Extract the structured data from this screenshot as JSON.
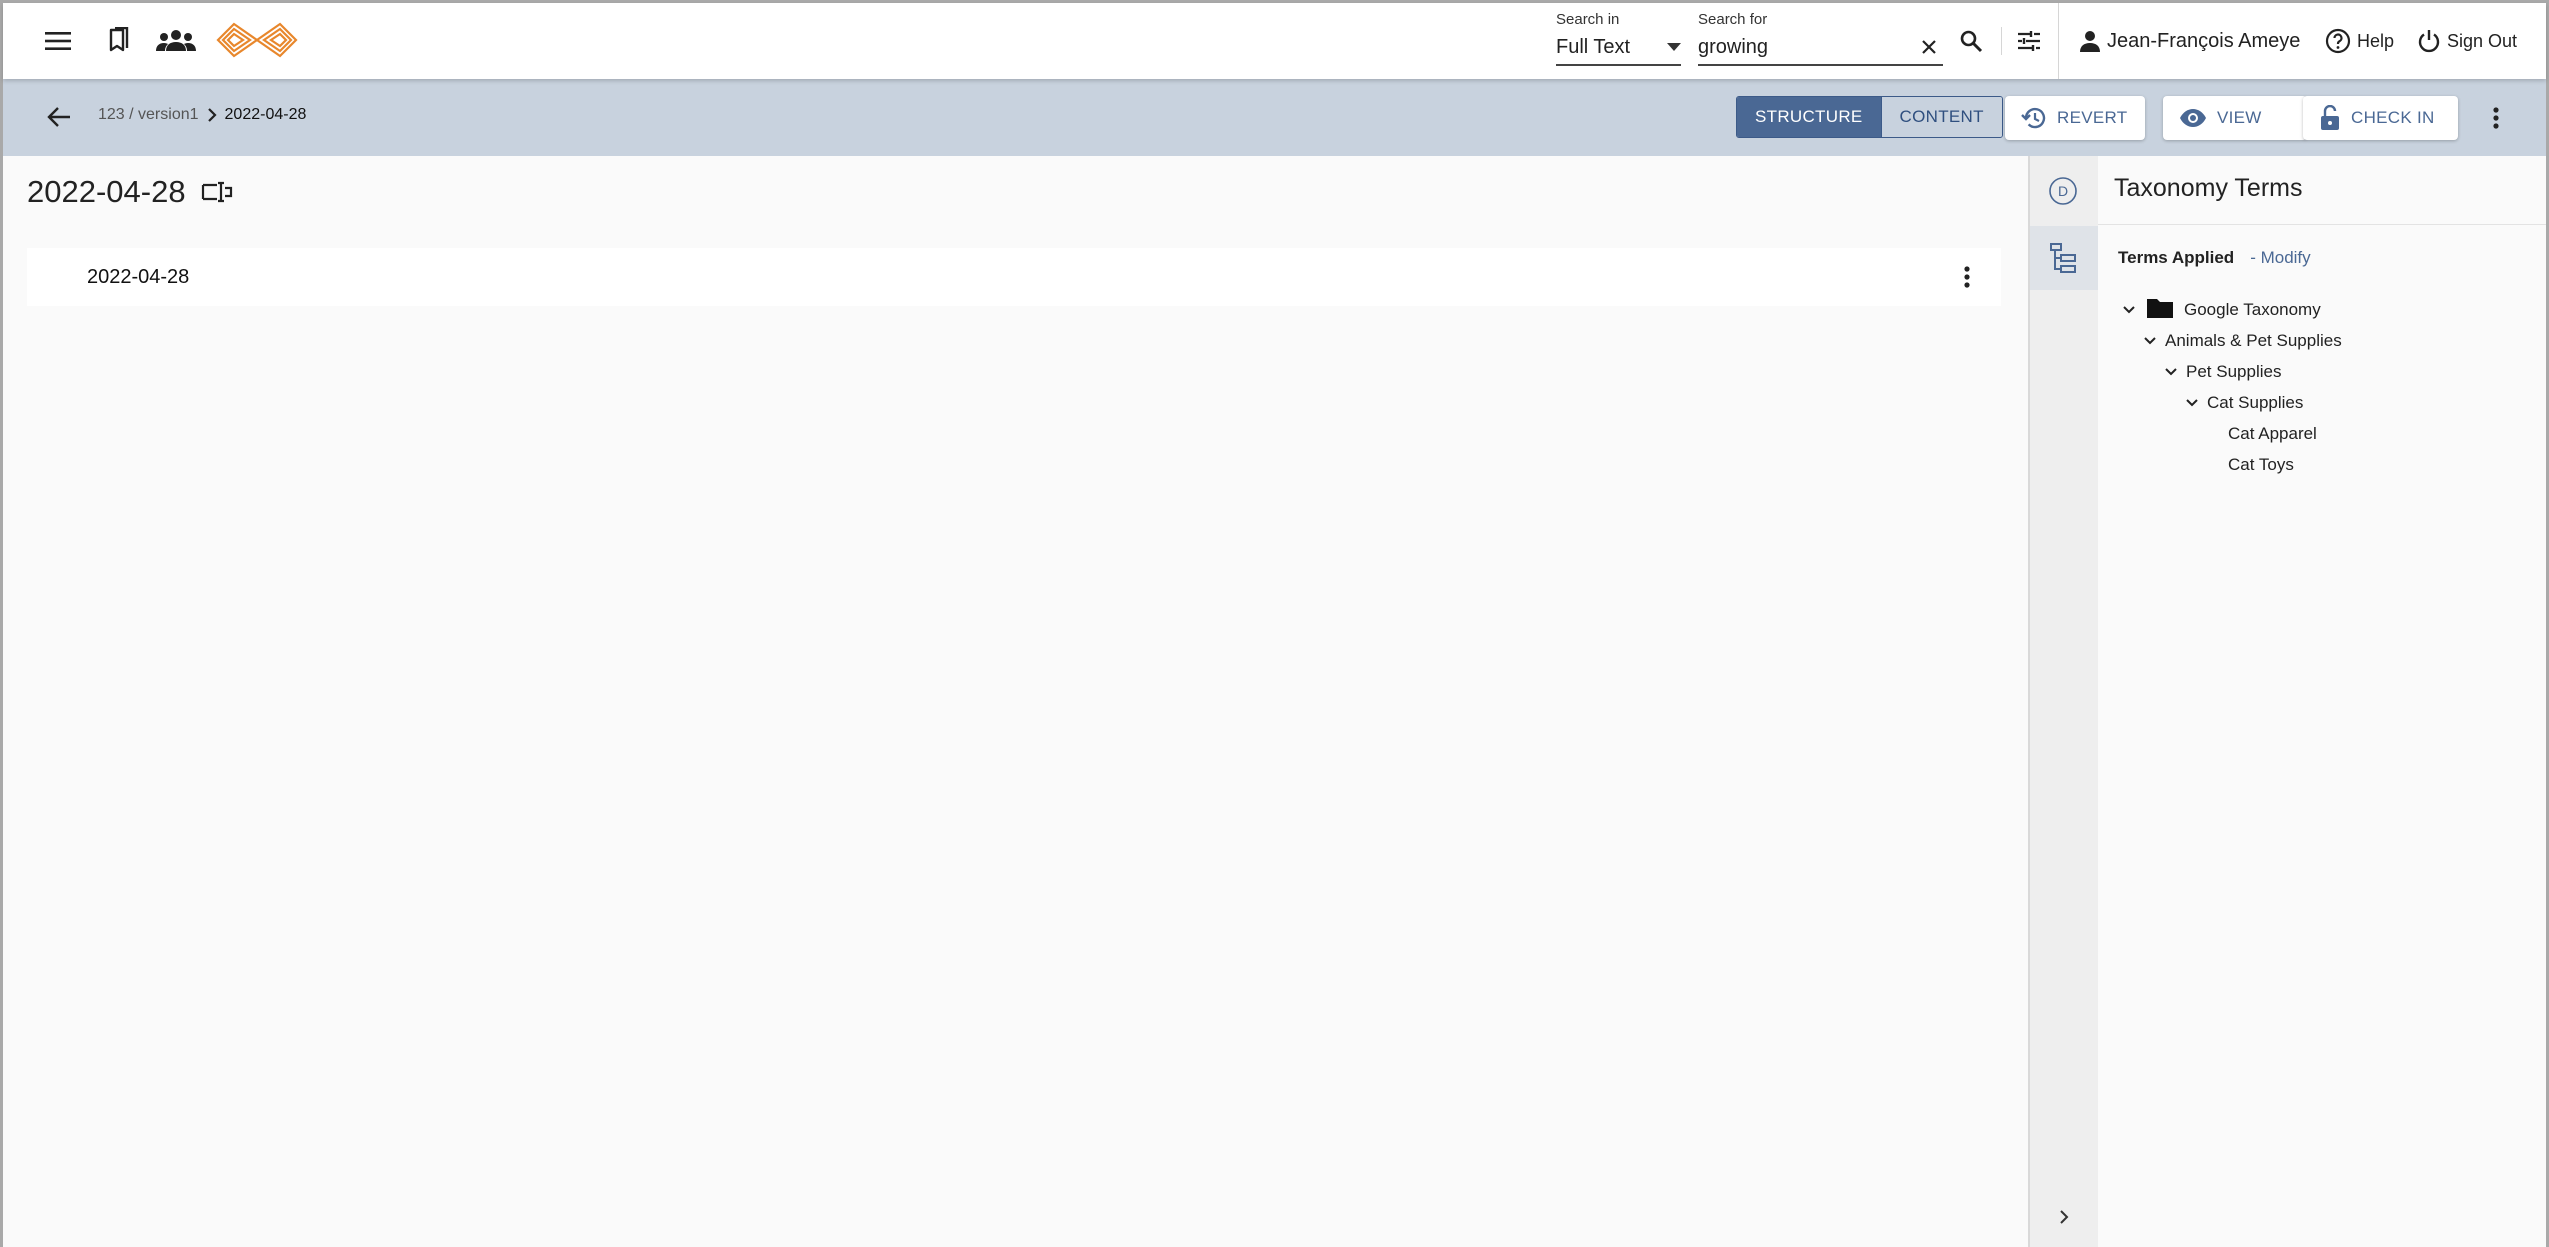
{
  "topbar": {
    "icons": [
      "menu-icon",
      "bookmark-icon",
      "groups-icon",
      "logo-icon"
    ],
    "search_in": {
      "label": "Search in",
      "value": "Full Text"
    },
    "search_for": {
      "label": "Search for",
      "value": "growing"
    },
    "user_name": "Jean-François Ameye",
    "help_label": "Help",
    "signout_label": "Sign Out"
  },
  "subbar": {
    "breadcrumb_parent": "123 / version1",
    "breadcrumb_current": "2022-04-28",
    "toggle": {
      "structure": "STRUCTURE",
      "content": "CONTENT",
      "active": "structure"
    },
    "revert_label": "REVERT",
    "view_label": "VIEW",
    "checkin_label": "CHECK IN"
  },
  "main": {
    "title": "2022-04-28",
    "rows": [
      {
        "label": "2022-04-28"
      }
    ]
  },
  "rail": {
    "d_label": "D"
  },
  "panel": {
    "title": "Taxonomy Terms",
    "terms_applied": "Terms Applied",
    "modify": "- Modify",
    "tree": [
      {
        "label": "Google Taxonomy",
        "level": 0,
        "expanded": true,
        "folder": true
      },
      {
        "label": "Animals & Pet Supplies",
        "level": 1,
        "expanded": true
      },
      {
        "label": "Pet Supplies",
        "level": 2,
        "expanded": true
      },
      {
        "label": "Cat Supplies",
        "level": 3,
        "expanded": true
      },
      {
        "label": "Cat Apparel",
        "level": 4,
        "expanded": false
      },
      {
        "label": "Cat Toys",
        "level": 4,
        "expanded": false
      }
    ]
  },
  "colors": {
    "accent": "#4a6894",
    "subbar_bg": "#c8d2de",
    "logo": "#e8872c"
  }
}
